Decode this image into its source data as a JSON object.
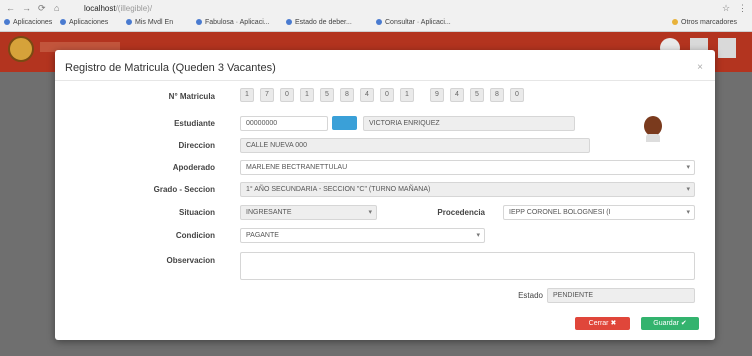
{
  "browser": {
    "url_host": "localhost",
    "url_path": "/(illegible)/",
    "bookmarks": [
      {
        "label": "Aplicaciones"
      },
      {
        "label": "Aplicaciones"
      },
      {
        "label": "Mis Mvdl En"
      },
      {
        "label": "Fabulosa · Aplicaci..."
      },
      {
        "label": "Estado de deber..."
      },
      {
        "label": "Consultar · Aplicaci..."
      },
      {
        "label": "Otros marcadores"
      }
    ]
  },
  "modal": {
    "title": "Registro de Matricula (Queden 3 Vacantes)",
    "close": "×",
    "labels": {
      "matricula": "N° Matricula",
      "estudiante": "Estudiante",
      "direccion": "Direccion",
      "apoderado": "Apoderado",
      "grado_seccion": "Grado - Seccion",
      "situacion": "Situacion",
      "procedencia": "Procedencia",
      "condicion": "Condicion",
      "observacion": "Observacion",
      "estado": "Estado"
    },
    "matricula_digits": [
      "1",
      "7",
      "0",
      "1",
      "5",
      "8",
      "4",
      "0",
      "1",
      "9",
      "4",
      "5",
      "8",
      "0"
    ],
    "estudiante_code": "00000000",
    "estudiante_name": "VICTORIA ENRIQUEZ",
    "direccion": "CALLE NUEVA 000",
    "apoderado": "MARLENE BECTRANETTULAU",
    "grado_seccion": "1° AÑO SECUNDARIA - SECCION \"C\" (TURNO MAÑANA)",
    "situacion": "INGRESANTE",
    "procedencia": "IEPP CORONEL BOLOGNESI (I",
    "condicion": "PAGANTE",
    "observacion": "",
    "estado": "PENDIENTE",
    "buttons": {
      "cancel": "Cerrar",
      "save": "Guardar"
    }
  }
}
